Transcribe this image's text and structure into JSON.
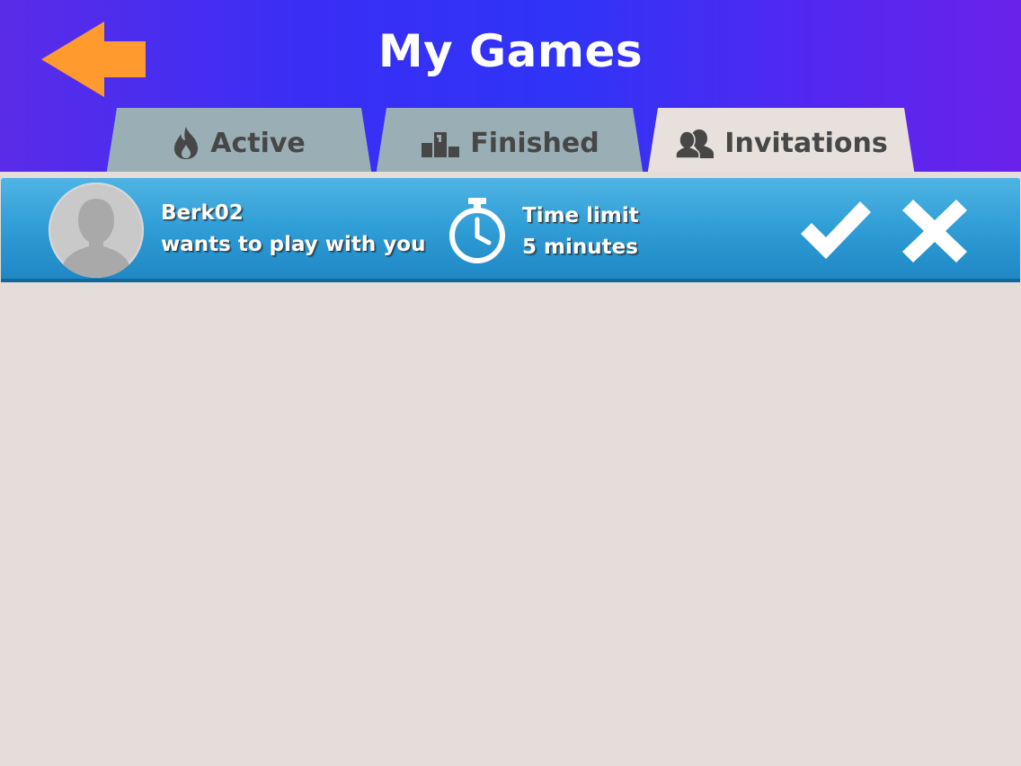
{
  "header": {
    "title": "My Games",
    "back_icon": "back-arrow-icon"
  },
  "tabs": [
    {
      "label": "Active",
      "icon": "flame-icon",
      "selected": false
    },
    {
      "label": "Finished",
      "icon": "podium-icon",
      "selected": false
    },
    {
      "label": "Invitations",
      "icon": "users-icon",
      "selected": true
    }
  ],
  "invitations": [
    {
      "username": "Berk02",
      "message": "wants to play with you",
      "time_limit_label": "Time limit",
      "time_limit_value": "5 minutes"
    }
  ],
  "colors": {
    "accent_back": "#ff9a2e",
    "tab_inactive": "#9aaeb6",
    "tab_selected": "#e8e0dc",
    "row_blue": "#2f9dd6",
    "panel_bg": "#e5ddd9"
  }
}
